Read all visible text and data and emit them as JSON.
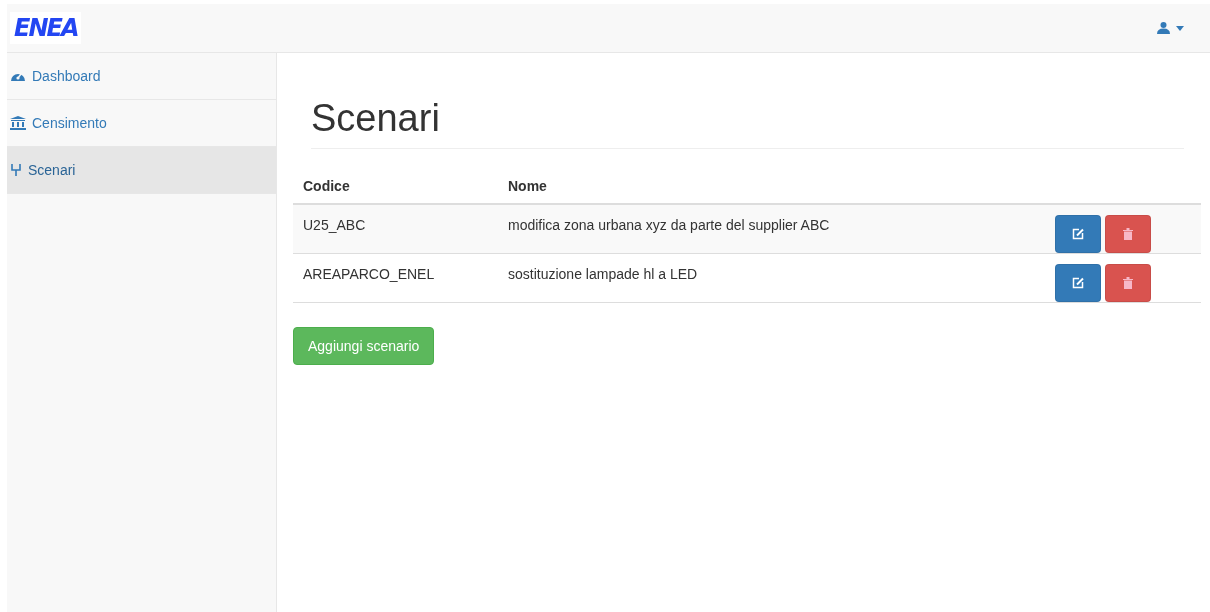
{
  "logo": {
    "text": "ENEA"
  },
  "sidebar": {
    "items": [
      {
        "label": "Dashboard",
        "selected": false
      },
      {
        "label": "Censimento",
        "selected": false
      },
      {
        "label": "Scenari",
        "selected": true
      }
    ]
  },
  "page": {
    "title": "Scenari"
  },
  "table": {
    "columns": [
      "Codice",
      "Nome"
    ],
    "rows": [
      {
        "codice": "U25_ABC",
        "nome": "modifica zona urbana xyz da parte del supplier ABC"
      },
      {
        "codice": "AREAPARCO_ENEL",
        "nome": "sostituzione lampade hl a LED"
      }
    ]
  },
  "add_button": "Aggiungi scenario"
}
